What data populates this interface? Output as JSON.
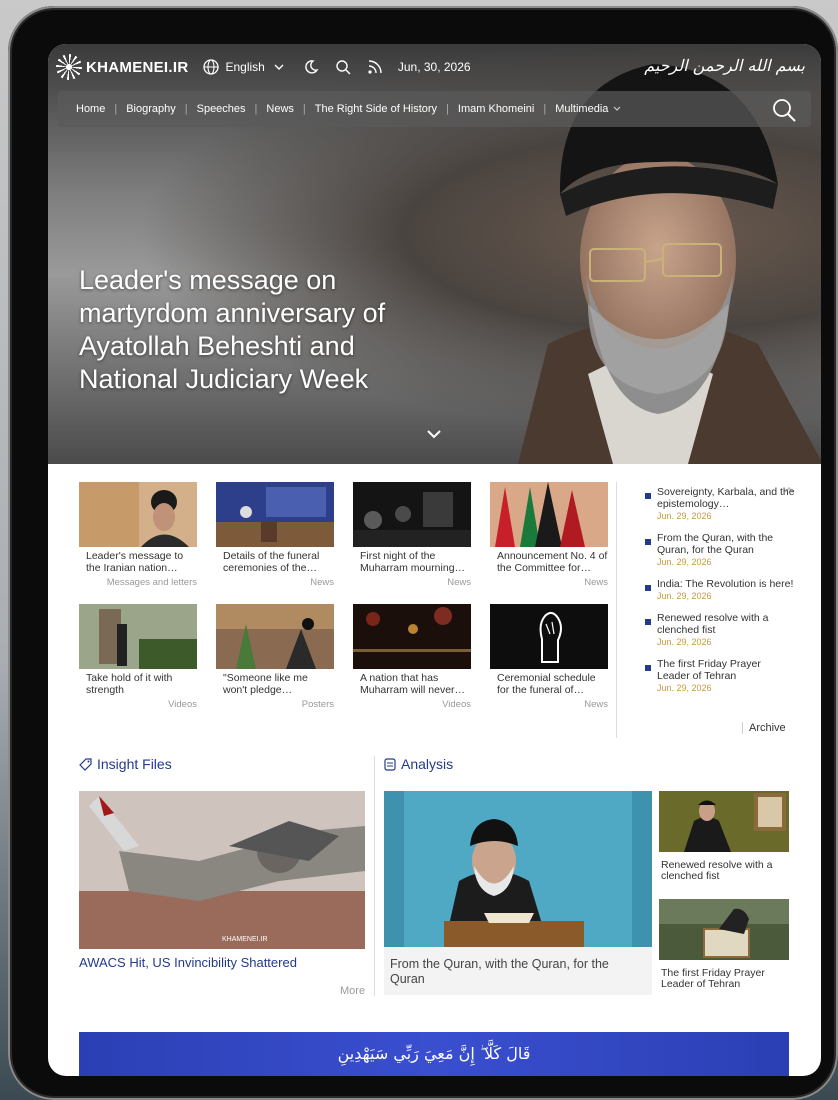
{
  "header": {
    "logo_text": "KHAMENEI.IR",
    "language": "English",
    "date": "Jun, 30, 2026",
    "calligraphy": "بسم الله الرحمن الرحيم"
  },
  "nav": {
    "items": [
      "Home",
      "Biography",
      "Speeches",
      "News",
      "The Right Side of History",
      "Imam Khomeini",
      "Multimedia"
    ]
  },
  "hero": {
    "title": "Leader's message on martyrdom anniversary of Ayatollah Beheshti and National Judiciary Week"
  },
  "news_cards": [
    {
      "title": "Leader's message to the Iranian nation…",
      "category": "Messages and letters"
    },
    {
      "title": "Details of the funeral ceremonies of the…",
      "category": "News"
    },
    {
      "title": "First night of the Muharram mourning…",
      "category": "News"
    },
    {
      "title": "Announcement No. 4 of the Committee for…",
      "category": "News"
    },
    {
      "title": "Take hold of it with strength",
      "category": "Videos"
    },
    {
      "title": "\"Someone like me won't pledge…",
      "category": "Posters"
    },
    {
      "title": "A nation that has Muharram will never…",
      "category": "Videos"
    },
    {
      "title": "Ceremonial schedule for the funeral of…",
      "category": "News"
    }
  ],
  "latest": [
    {
      "title": "Sovereignty, Karbala, and the epistemology…",
      "date": "Jun. 29, 2026"
    },
    {
      "title": "From the Quran, with the Quran, for the Quran",
      "date": "Jun. 29, 2026"
    },
    {
      "title": "India: The Revolution is here!",
      "date": "Jun. 29, 2026"
    },
    {
      "title": "Renewed resolve with a clenched fist",
      "date": "Jun. 29, 2026"
    },
    {
      "title": "The first Friday Prayer Leader of Tehran",
      "date": "Jun. 29, 2026"
    }
  ],
  "archive_label": "Archive",
  "insight": {
    "heading": "Insight Files",
    "title": "AWACS Hit, US Invincibility Shattered",
    "more_label": "More",
    "watermark": "KHAMENEI.IR"
  },
  "analysis": {
    "heading": "Analysis",
    "main_title": "From the Quran, with the Quran, for the Quran",
    "side": [
      {
        "title": "Renewed resolve with a clenched fist"
      },
      {
        "title": "The first Friday Prayer Leader of Tehran"
      }
    ]
  },
  "quote": "قَالَ كَلَّا ۖ إِنَّ مَعِيَ رَبِّي سَيَهْدِينِ",
  "colors": {
    "accent": "#243a8a",
    "date_gold": "#c59a3d",
    "banner": "#3a4fd0"
  }
}
